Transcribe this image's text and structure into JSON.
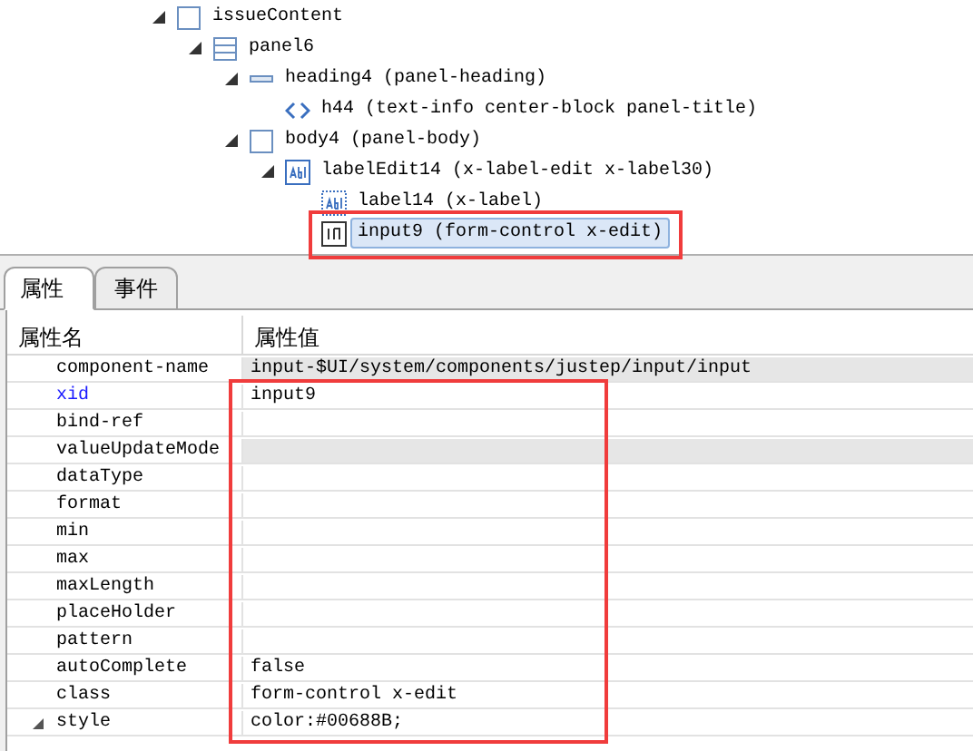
{
  "tree": [
    {
      "label": "issueContent",
      "kind": "box",
      "expanded": true,
      "selected": false,
      "children": [
        {
          "label": "panel6",
          "kind": "panel",
          "expanded": true,
          "selected": false,
          "children": [
            {
              "label": "heading4 (panel-heading)",
              "kind": "heading",
              "expanded": true,
              "selected": false,
              "children": [
                {
                  "label": "h44 (text-info center-block panel-title)",
                  "kind": "code",
                  "expanded": false,
                  "selected": false
                }
              ]
            },
            {
              "label": "body4 (panel-body)",
              "kind": "box",
              "expanded": true,
              "selected": false,
              "children": [
                {
                  "label": "labelEdit14 (x-label-edit x-label30)",
                  "kind": "label-edit",
                  "expanded": true,
                  "selected": false,
                  "children": [
                    {
                      "label": "label14 (x-label)",
                      "kind": "label",
                      "expanded": false,
                      "selected": false
                    },
                    {
                      "label": "input9 (form-control x-edit)",
                      "kind": "input",
                      "expanded": false,
                      "selected": true
                    }
                  ]
                }
              ]
            }
          ]
        }
      ]
    }
  ],
  "tabs": [
    {
      "label": "属性",
      "selected": true
    },
    {
      "label": "事件",
      "selected": false
    }
  ],
  "table": {
    "columns": [
      "属性名",
      "属性值"
    ],
    "rows": [
      {
        "name": "component-name",
        "value": "input-$UI/system/components/justep/input/input",
        "highlighted": false,
        "shaded": true
      },
      {
        "name": "xid",
        "value": "input9",
        "highlighted": true,
        "shaded": false
      },
      {
        "name": "bind-ref",
        "highlighted": false,
        "shaded": false
      },
      {
        "name": "valueUpdateMode",
        "highlighted": false,
        "shaded": true
      },
      {
        "name": "dataType",
        "highlighted": false,
        "shaded": false
      },
      {
        "name": "format",
        "highlighted": false,
        "shaded": false
      },
      {
        "name": "min",
        "highlighted": false,
        "shaded": false
      },
      {
        "name": "max",
        "highlighted": false,
        "shaded": false
      },
      {
        "name": "maxLength",
        "highlighted": false,
        "shaded": false
      },
      {
        "name": "placeHolder",
        "highlighted": false,
        "shaded": false
      },
      {
        "name": "pattern",
        "highlighted": false,
        "shaded": false
      },
      {
        "name": "autoComplete",
        "value": "false",
        "highlighted": false,
        "shaded": false
      },
      {
        "name": "class",
        "value": "form-control x-edit",
        "highlighted": false,
        "shaded": false
      },
      {
        "name": "style",
        "value": "color:#00688B;",
        "highlighted": false,
        "shaded": false,
        "expanded": true
      }
    ]
  }
}
